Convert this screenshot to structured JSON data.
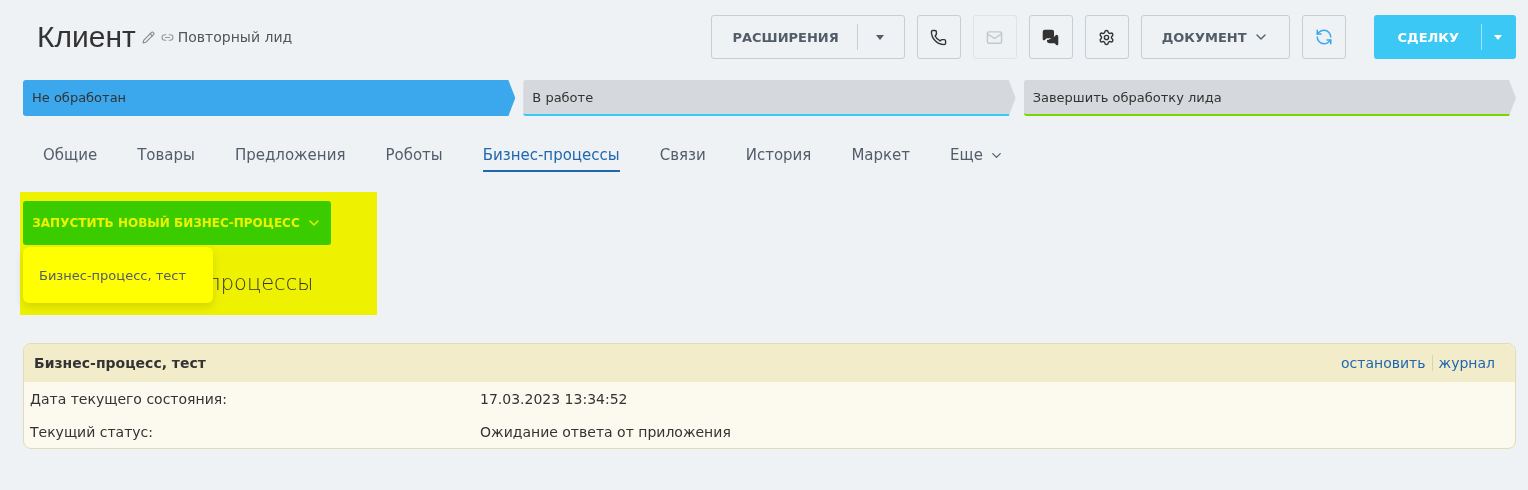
{
  "header": {
    "title": "Клиент",
    "subtitle": "Повторный лид"
  },
  "toolbar": {
    "extensions": "РАСШИРЕНИЯ",
    "icon_buttons": [
      {
        "kind": "phone",
        "disabled": false
      },
      {
        "kind": "mail",
        "disabled": true
      },
      {
        "kind": "chat",
        "disabled": false
      },
      {
        "kind": "settings",
        "disabled": false
      }
    ],
    "document": "ДОКУМЕНТ",
    "primary": "СДЕЛКУ"
  },
  "stages": [
    {
      "label": "Не обработан",
      "selected": true,
      "color": "#3ba7ec"
    },
    {
      "label": "В работе",
      "selected": false,
      "color": "#3bc8f5"
    },
    {
      "label": "Завершить обработку лида",
      "selected": false,
      "color": "#7bd500"
    }
  ],
  "tabs": [
    {
      "label": "Общие",
      "selected": false
    },
    {
      "label": "Товары",
      "selected": false
    },
    {
      "label": "Предложения",
      "selected": false
    },
    {
      "label": "Роботы",
      "selected": false
    },
    {
      "label": "Бизнес-процессы",
      "selected": true
    },
    {
      "label": "Связи",
      "selected": false
    },
    {
      "label": "История",
      "selected": false
    },
    {
      "label": "Маркет",
      "selected": false
    },
    {
      "label": "Еще",
      "selected": false
    }
  ],
  "start_button": "ЗАПУСТИТЬ НОВЫЙ БИЗНЕС-ПРОЦЕСС",
  "start_menu": [
    "Бизнес-процесс, тест"
  ],
  "section_heading": "процессы",
  "process": {
    "title": "Бизнес-процесс, тест",
    "actions": [
      "остановить",
      "журнал"
    ],
    "fields": [
      {
        "label": "Дата текущего состояния:",
        "value": "17.03.2023 13:34:52"
      },
      {
        "label": "Текущий статус:",
        "value": "Ожидание ответа от приложения"
      }
    ]
  }
}
